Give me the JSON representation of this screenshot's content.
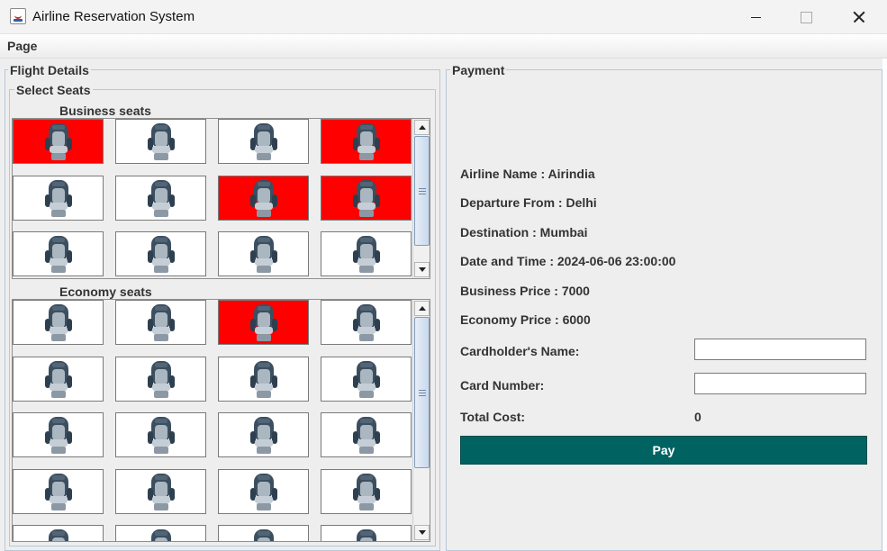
{
  "window": {
    "title": "Airline Reservation System"
  },
  "menu": {
    "page_label": "Page"
  },
  "flight_details": {
    "title": "Flight Details",
    "select_seats_title": "Select Seats",
    "business": {
      "label": "Business seats",
      "seats": [
        "booked",
        "available",
        "available",
        "booked",
        "available",
        "available",
        "booked",
        "booked",
        "available",
        "available",
        "available",
        "available"
      ],
      "scroll_position": 0.0
    },
    "economy": {
      "label": "Economy seats",
      "seats": [
        "available",
        "available",
        "booked",
        "available",
        "available",
        "available",
        "available",
        "available",
        "available",
        "available",
        "available",
        "available",
        "available",
        "available",
        "available",
        "available",
        "available",
        "available",
        "available",
        "available"
      ],
      "scroll_position": 0.0
    }
  },
  "payment": {
    "title": "Payment",
    "airline_name": "Airline Name : Airindia",
    "departure": "Departure From : Delhi",
    "destination": "Destination : Mumbai",
    "date_time": "Date and Time : 2024-06-06 23:00:00",
    "business_price": "Business Price : 7000",
    "economy_price": "Economy Price : 6000",
    "cardholder_label": "Cardholder's Name:",
    "cardholder_value": "",
    "card_number_label": "Card Number:",
    "card_number_value": "",
    "total_cost_label": "Total Cost:",
    "total_cost_value": "0",
    "pay_label": "Pay"
  },
  "colors": {
    "booked": "#ff0000",
    "available": "#ffffff",
    "pay_button": "#006362"
  },
  "icons": {
    "seat": "seat-icon",
    "app": "java-icon"
  }
}
